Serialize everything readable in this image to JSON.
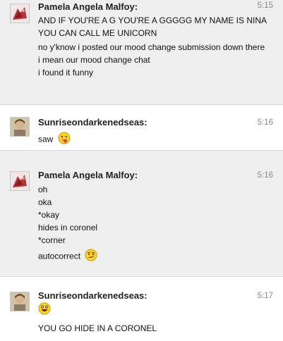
{
  "messages": [
    {
      "author": "Pamela Angela Malfoy:",
      "time": "5:15",
      "avatar_icon": "pamela-avatar",
      "lines": [
        "AND IF YOU'RE A G YOU'RE A GGGGG MY NAME IS NINA YOU CAN CALL ME UNICORN",
        "no y'know i posted our mood change submission down there",
        "i mean our mood change chat",
        "i found it funny"
      ]
    },
    {
      "author": "Sunriseondarkenedseas:",
      "time": "5:16",
      "avatar_icon": "sunrise-avatar",
      "lines": [
        "saw"
      ],
      "emoji": "tongue-out-emoji-icon"
    },
    {
      "author": "Pamela Angela Malfoy:",
      "time": "5:16",
      "avatar_icon": "pamela-avatar",
      "lines": [
        "oh",
        "oka",
        "*okay",
        "hides in coronel",
        "*corner",
        "autocorrect"
      ],
      "emoji": "thinking-emoji-icon"
    },
    {
      "author": "Sunriseondarkenedseas:",
      "time": "5:17",
      "avatar_icon": "sunrise-avatar",
      "lines": [
        "YOU GO HIDE IN A CORONEL"
      ],
      "emoji": "laughing-emoji-icon"
    }
  ]
}
